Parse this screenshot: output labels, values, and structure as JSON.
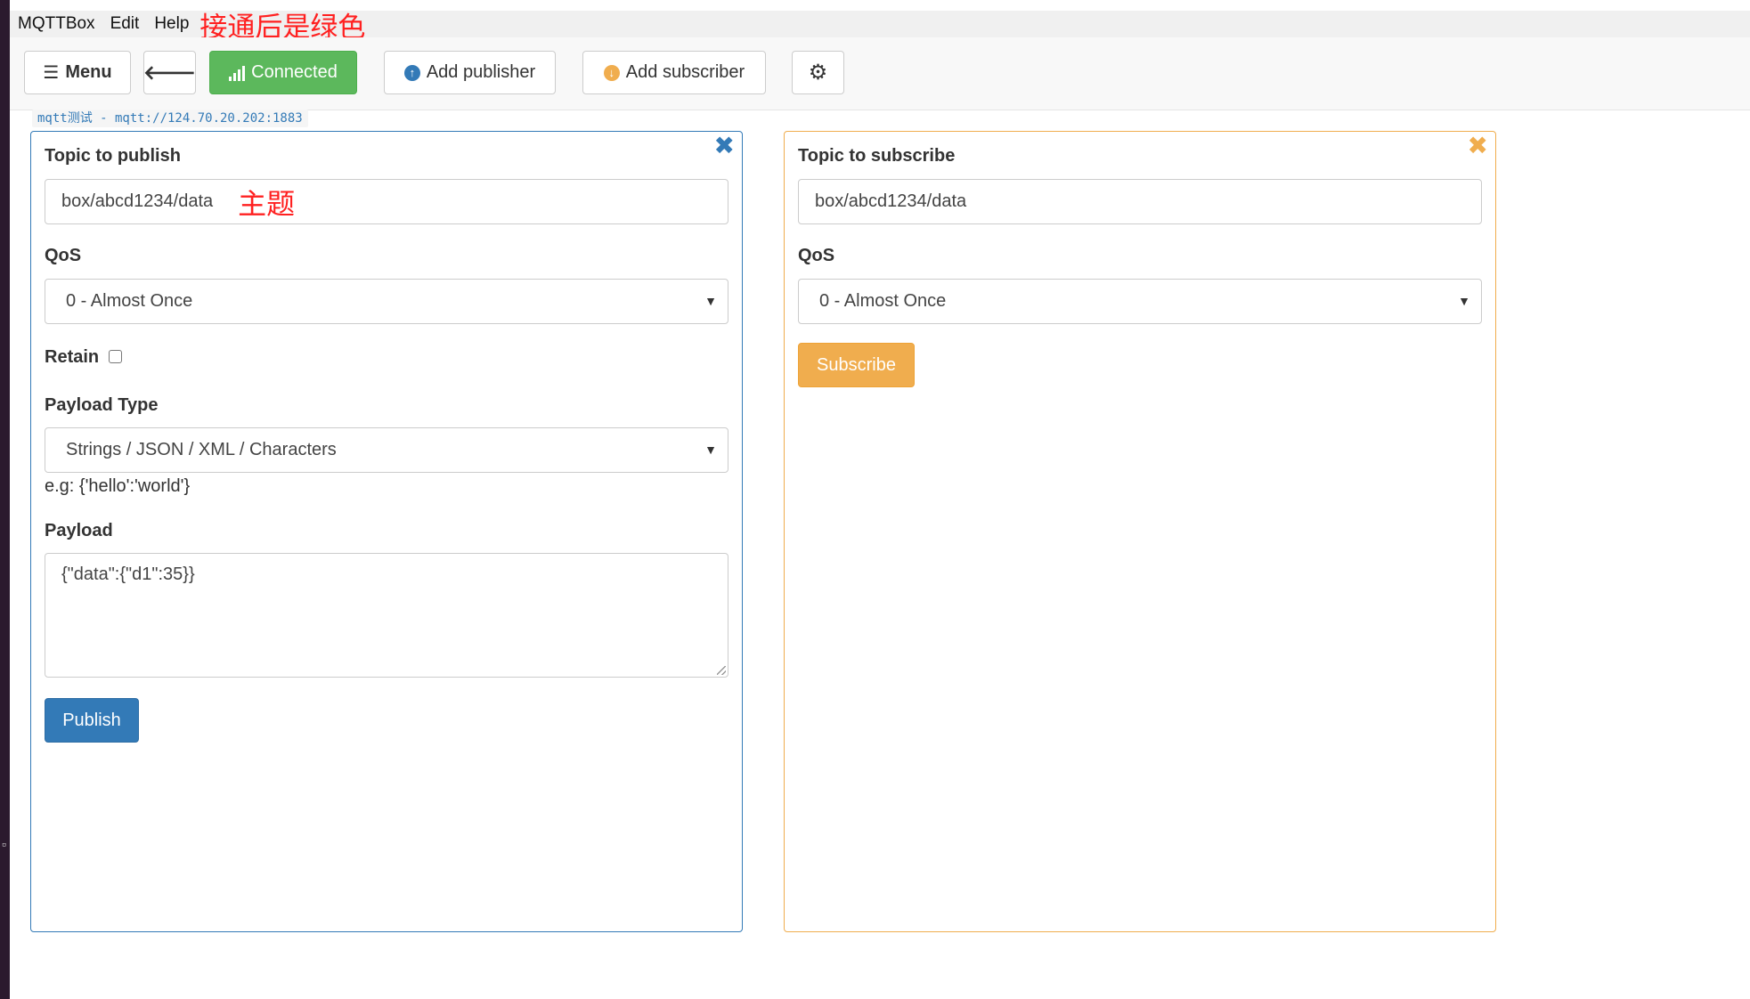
{
  "menubar": {
    "items": [
      "MQTTBox",
      "Edit",
      "Help"
    ],
    "annotation": "接通后是绿色"
  },
  "toolbar": {
    "menu_label": "Menu",
    "back_icon": "arrow-left-icon",
    "connected_label": "Connected",
    "add_publisher_label": "Add publisher",
    "add_subscriber_label": "Add subscriber",
    "settings_icon": "gear-icon"
  },
  "connection": {
    "label": "mqtt测试 - mqtt://124.70.20.202:1883"
  },
  "publisher": {
    "close_icon": "close-icon",
    "topic_label": "Topic to publish",
    "topic_value": "box/abcd1234/data",
    "topic_annotation": "主题",
    "qos_label": "QoS",
    "qos_value": "0 - Almost Once",
    "retain_label": "Retain",
    "retain_checked": false,
    "payload_type_label": "Payload Type",
    "payload_type_value": "Strings / JSON / XML / Characters",
    "payload_hint": "e.g: {'hello':'world'}",
    "payload_label": "Payload",
    "payload_value": "{\"data\":{\"d1\":35}}",
    "publish_label": "Publish"
  },
  "subscriber": {
    "close_icon": "close-icon",
    "topic_label": "Topic to subscribe",
    "topic_value": "box/abcd1234/data",
    "qos_label": "QoS",
    "qos_value": "0 - Almost Once",
    "subscribe_label": "Subscribe"
  },
  "colors": {
    "connected": "#5cb85c",
    "publisher_accent": "#337ab7",
    "subscriber_accent": "#f0ad4e",
    "annotation": "#ff2020"
  }
}
